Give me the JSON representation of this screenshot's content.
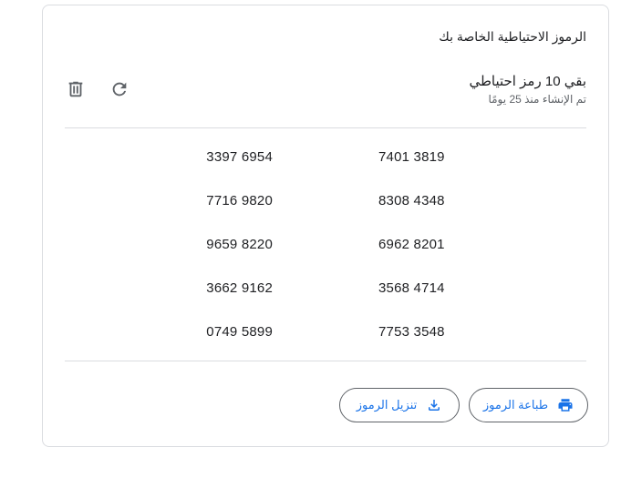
{
  "card": {
    "title": "الرموز الاحتياطية الخاصة بك",
    "status_main": "بقي 10 رمز احتياطي",
    "status_sub": "تم الإنشاء منذ 25 يومًا"
  },
  "toolbar": {
    "delete_icon": "trash-icon",
    "refresh_icon": "refresh-icon"
  },
  "codes": [
    {
      "right": "7401 3819",
      "left": "3397 6954"
    },
    {
      "right": "8308 4348",
      "left": "7716 9820"
    },
    {
      "right": "6962 8201",
      "left": "9659 8220"
    },
    {
      "right": "3568 4714",
      "left": "3662 9162"
    },
    {
      "right": "7753 3548",
      "left": "0749 5899"
    }
  ],
  "actions": {
    "print_label": "طباعة الرموز",
    "download_label": "تنزيل الرموز",
    "print_icon": "printer-icon",
    "download_icon": "download-icon"
  },
  "colors": {
    "accent": "#1a73e8",
    "text": "#202124",
    "secondary_text": "#5f6368",
    "border": "#dadce0"
  }
}
